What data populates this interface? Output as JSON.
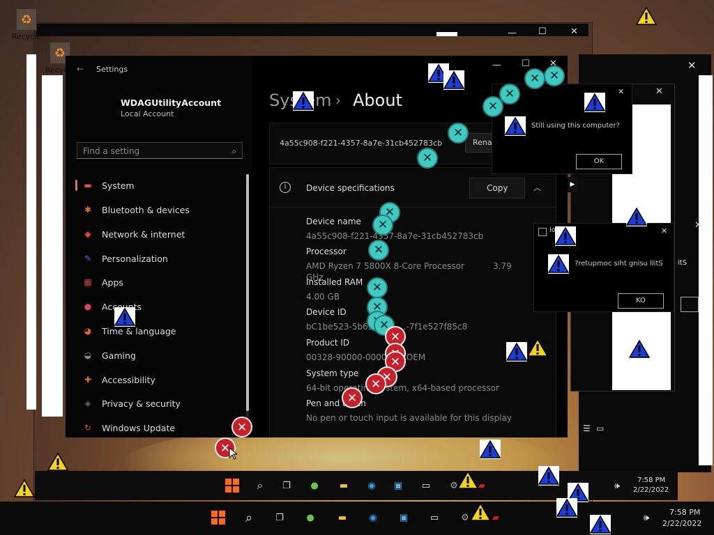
{
  "desktop": {
    "recycle_label_1": "Recycle",
    "recycle_label_2": "Recycle"
  },
  "settings": {
    "title": "Settings",
    "account_name": "WDAGUtilityAccount",
    "account_type": "Local Account",
    "search_placeholder": "Find a setting",
    "nav": [
      {
        "label": "System",
        "icon": "display-icon",
        "color": "#e0533a"
      },
      {
        "label": "Bluetooth & devices",
        "icon": "bluetooth-icon",
        "color": "#e07020"
      },
      {
        "label": "Network & internet",
        "icon": "wifi-icon",
        "color": "#e04040"
      },
      {
        "label": "Personalization",
        "icon": "brush-icon",
        "color": "#3a7ae0"
      },
      {
        "label": "Apps",
        "icon": "apps-icon",
        "color": "#d04040"
      },
      {
        "label": "Accounts",
        "icon": "person-icon",
        "color": "#e04060"
      },
      {
        "label": "Time & language",
        "icon": "globe-clock-icon",
        "color": "#e06030"
      },
      {
        "label": "Gaming",
        "icon": "gamepad-icon",
        "color": "#888888"
      },
      {
        "label": "Accessibility",
        "icon": "accessibility-icon",
        "color": "#e07020"
      },
      {
        "label": "Privacy & security",
        "icon": "shield-icon",
        "color": "#666666"
      },
      {
        "label": "Windows Update",
        "icon": "update-icon",
        "color": "#e06020"
      }
    ],
    "breadcrumb_parent": "System",
    "breadcrumb_sep": "›",
    "page_title": "About",
    "device_id_banner": "4a55c908-f221-4357-8a7e-31cb452783cb",
    "rename_label": "Rena",
    "spec_section_title": "Device specifications",
    "copy_label": "Copy",
    "specs": [
      {
        "label": "Device name",
        "value": "4a55c908-f221-4357-8a7e-31cb452783cb"
      },
      {
        "label": "Processor",
        "value": "AMD Ryzen 7 5800X 8-Core Processor",
        "value_extra": "3.79",
        "value_line2": "GHz"
      },
      {
        "label": "Installed RAM",
        "value": "4.00 GB"
      },
      {
        "label": "Device ID",
        "value": "bC1be523-5b65-4fe7-...-7f1e527f85c8"
      },
      {
        "label": "Product ID",
        "value": "00328-90000-00000-AAOEM"
      },
      {
        "label": "System type",
        "value": "64-bit operating system, x64-based processor"
      },
      {
        "label": "Pen and touch",
        "value": "No pen or touch input is available for this display"
      }
    ]
  },
  "dialog1": {
    "message": "Still using this computer?",
    "ok_label": "OK"
  },
  "dialog2": {
    "title": "lo",
    "message": "?retupmoc siht gnisu llitS",
    "ok_label": "KO",
    "partial_text": "itS"
  },
  "taskbar_inner": {
    "time": "7:58 PM",
    "date": "2/22/2022"
  },
  "taskbar_outer": {
    "time": "7:58 PM",
    "date": "2/22/2022"
  },
  "colors": {
    "warning_blue": "#1a3ed8",
    "warning_yellow": "#f2d21a",
    "error_red": "#c8202a",
    "teal": "#3fc9c0",
    "accent_orange": "#ff6a1a"
  }
}
